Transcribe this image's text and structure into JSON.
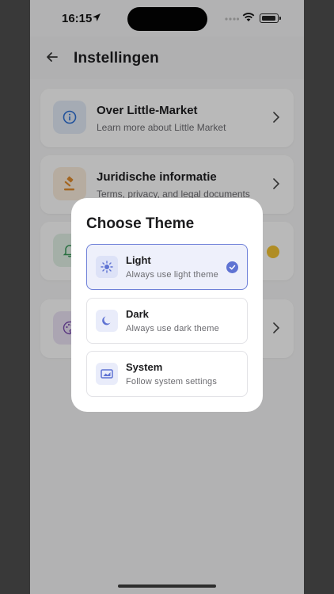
{
  "status": {
    "time": "16:15"
  },
  "appbar": {
    "title": "Instellingen"
  },
  "settings": [
    {
      "title": "Over Little-Market",
      "subtitle": "Learn more about Little Market",
      "icon": "info-icon",
      "color": "#2c6fd6"
    },
    {
      "title": "Juridische informatie",
      "subtitle": "Terms, privacy, and legal documents",
      "icon": "gavel-icon",
      "color": "#e08a2a"
    },
    {
      "title": "",
      "subtitle": "",
      "icon": "bell-icon",
      "color": "#3a9a5a"
    },
    {
      "title": "",
      "subtitle": "",
      "icon": "palette-icon",
      "color": "#7a4ab0"
    }
  ],
  "dialog": {
    "title": "Choose Theme",
    "options": [
      {
        "label": "Light",
        "desc": "Always use light theme",
        "icon": "sun-icon",
        "selected": true
      },
      {
        "label": "Dark",
        "desc": "Always use dark theme",
        "icon": "moon-icon",
        "selected": false
      },
      {
        "label": "System",
        "desc": "Follow system settings",
        "icon": "system-screen-icon",
        "selected": false
      }
    ]
  },
  "colors": {
    "accent": "#5f73d3",
    "selected_bg": "#eef0fb"
  }
}
